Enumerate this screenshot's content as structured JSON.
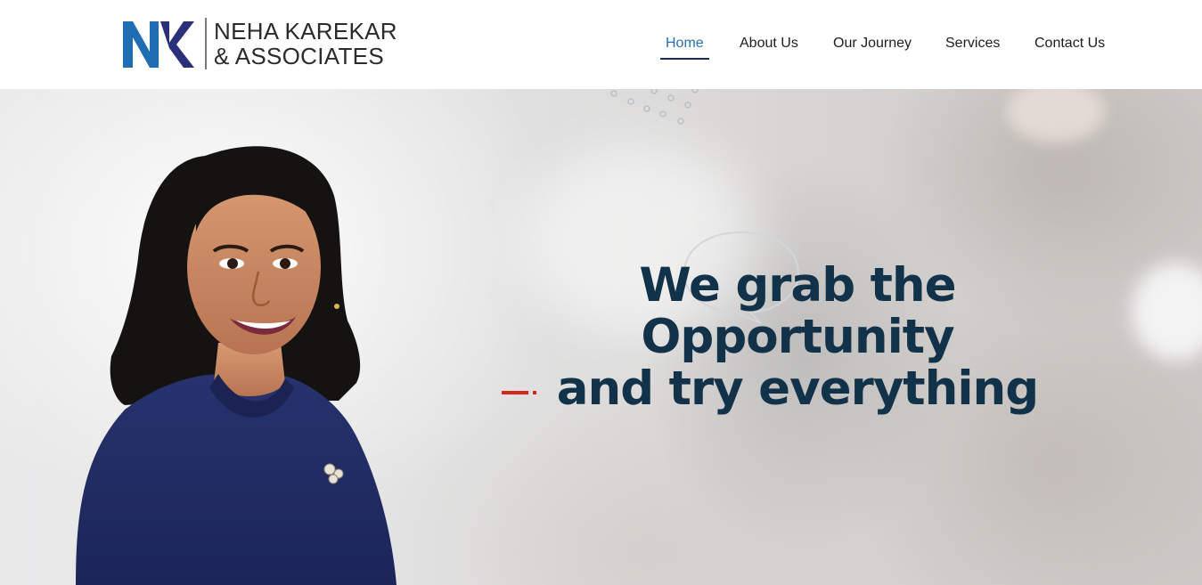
{
  "brand": {
    "line1": "NEHA KAREKAR",
    "line2": "& ASSOCIATES",
    "monogram_left": "N",
    "monogram_right": "K",
    "color_dark_blue": "#2a2f7a",
    "color_light_blue": "#1f6db3"
  },
  "nav": {
    "items": [
      {
        "label": "Home",
        "active": true
      },
      {
        "label": "About Us",
        "active": false
      },
      {
        "label": "Our Journey",
        "active": false
      },
      {
        "label": "Services",
        "active": false
      },
      {
        "label": "Contact Us",
        "active": false
      }
    ],
    "active_color": "#2a6fb3",
    "underline_color": "#1f2a5a"
  },
  "hero": {
    "headline_line1": "We grab the Opportunity",
    "headline_line2": "and try everything",
    "headline_color": "#12324a",
    "accent_color": "#d9261c"
  },
  "icons": [
    "dots-pattern-icon",
    "speech-bubble-icon"
  ]
}
